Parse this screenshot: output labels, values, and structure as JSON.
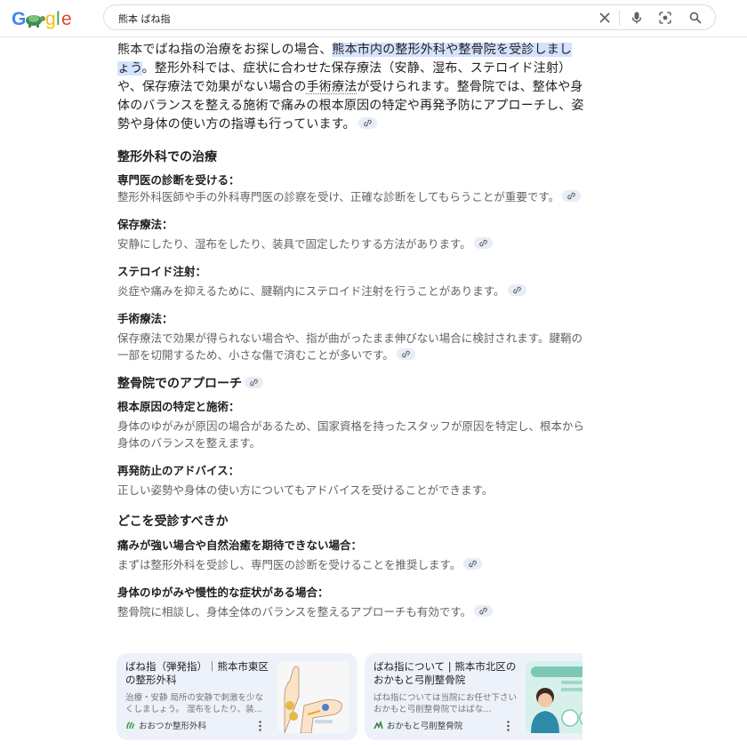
{
  "search": {
    "query": "熊本 ばね指"
  },
  "overview": {
    "lead_before": "熊本でばね指の治療をお探しの場合、",
    "lead_highlight": "熊本市内の整形外科や整骨院を受診しましょう",
    "lead_mid1": "。整形外科では、症状に合わせた保存療法（安静、湿布、ステロイド注射）や、保存療法で効果がない場合の",
    "lead_link": "手術療法",
    "lead_mid2": "が受けられます。整骨院では、整体や身体のバランスを整える施術で痛みの根本原因の特定や再発予防にアプローチし、姿勢や身体の使い方の指導も行っています。",
    "sections": [
      {
        "heading": "整形外科での治療",
        "items": [
          {
            "title": "専門医の診断を受ける：",
            "text": "整形外科医師や手の外科専門医の診察を受け、正確な診断をしてもらうことが重要です。"
          },
          {
            "title": "保存療法：",
            "text": "安静にしたり、湿布をしたり、装具で固定したりする方法があります。"
          },
          {
            "title": "ステロイド注射：",
            "text": "炎症や痛みを抑えるために、腱鞘内にステロイド注射を行うことがあります。"
          },
          {
            "title": "手術療法：",
            "text": "保存療法で効果が得られない場合や、指が曲がったまま伸びない場合に検討されます。腱鞘の一部を切開するため、小さな傷で済むことが多いです。"
          }
        ]
      },
      {
        "heading": "整骨院でのアプローチ",
        "items": [
          {
            "title": "根本原因の特定と施術：",
            "text": "身体のゆがみが原因の場合があるため、国家資格を持ったスタッフが原因を特定し、根本から身体のバランスを整えます。"
          },
          {
            "title": "再発防止のアドバイス：",
            "text": "正しい姿勢や身体の使い方についてもアドバイスを受けることができます。"
          }
        ]
      },
      {
        "heading": "どこを受診すべきか",
        "items": [
          {
            "title": "痛みが強い場合や自然治癒を期待できない場合：",
            "text": "まずは整形外科を受診し、専門医の診断を受けることを推奨します。"
          },
          {
            "title": "身体のゆがみや慢性的な症状がある場合：",
            "text": "整骨院に相談し、身体全体のバランスを整えるアプローチも有効です。"
          }
        ]
      }
    ]
  },
  "cards": [
    {
      "title": "ばね指（弾発指）｜熊本市東区の整形外科",
      "snippet": "治療・安静 局所の安静で刺激を少なくしましょう。 湿布をしたり、装...",
      "source": "おおつか整形外科"
    },
    {
      "title": "ばね指について | 熊本市北区のおかもと弓削整骨院",
      "snippet": "ばね指については当院にお任せ下さい おかもと弓削整骨院ではばな...",
      "source": "おかもと弓削整骨院"
    }
  ],
  "colors": {
    "highlight": "#d3e3fd",
    "chip": "#e8ecf6",
    "card_bg": "#edf2fa",
    "muted_text": "#5f6368"
  }
}
